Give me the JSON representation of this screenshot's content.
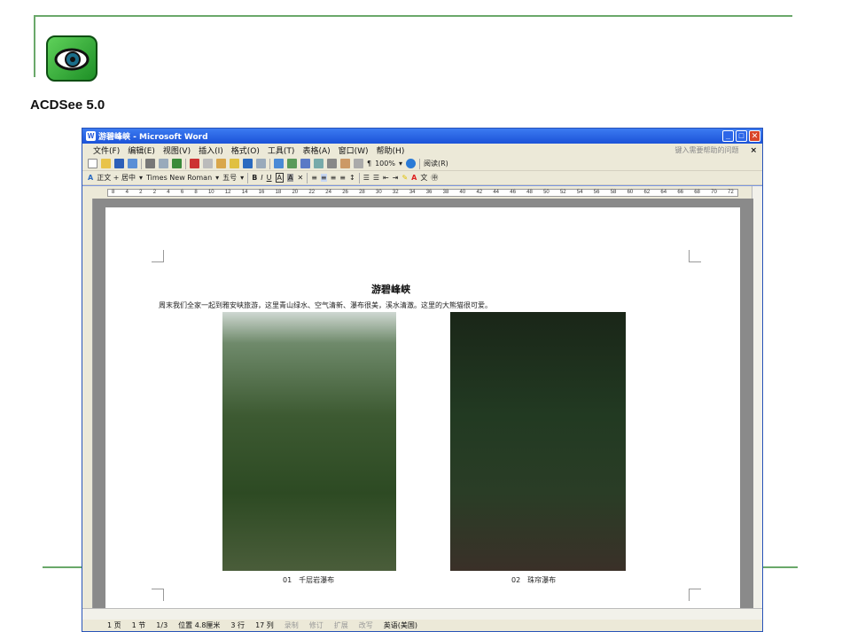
{
  "brand": {
    "name": "ACDSee 5.0"
  },
  "window": {
    "title": "游碧峰峡 - Microsoft Word",
    "menu": [
      "文件(F)",
      "编辑(E)",
      "视图(V)",
      "插入(I)",
      "格式(O)",
      "工具(T)",
      "表格(A)",
      "窗口(W)",
      "帮助(H)"
    ],
    "help_placeholder": "键入需要帮助的问题",
    "zoom": "100%",
    "read_label": "阅读(R)",
    "style": "正文 + 居中",
    "font": "Times New Roman",
    "size": "五号"
  },
  "ruler_ticks": [
    "8",
    "4",
    "2",
    "2",
    "4",
    "6",
    "8",
    "10",
    "12",
    "14",
    "16",
    "18",
    "20",
    "22",
    "24",
    "26",
    "28",
    "30",
    "32",
    "34",
    "36",
    "38",
    "40",
    "42",
    "44",
    "46",
    "48",
    "50",
    "52",
    "54",
    "56",
    "58",
    "60",
    "62",
    "64",
    "66",
    "68",
    "70",
    "72"
  ],
  "document": {
    "heading": "游碧峰峡",
    "paragraph": "周末我们全家一起到雅安峡旅游，这里青山绿水、空气清新、瀑布很美，溪水清澈。这里的大熊猫很可爱。",
    "caption1": "01　千层岩瀑布",
    "caption2": "02　珠帘瀑布"
  },
  "status": {
    "page": "1 页",
    "section": "1 节",
    "pages": "1/3",
    "position": "位置 4.8厘米",
    "line": "3 行",
    "column": "17 列",
    "rec": "录制",
    "trk": "修订",
    "ext": "扩展",
    "ovr": "改写",
    "lang": "英语(美国)"
  }
}
